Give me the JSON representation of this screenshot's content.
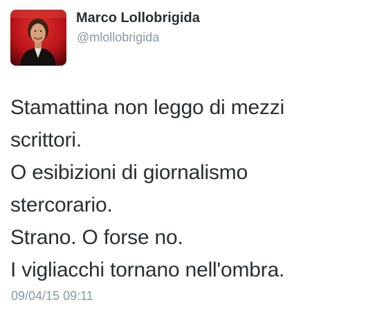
{
  "tweet": {
    "author": {
      "name": "Marco Lollobrigida",
      "handle": "@mlollobrigida",
      "avatar": "profile-photo"
    },
    "text_lines": [
      "Stamattina non leggo di mezzi",
      "scrittori.",
      "O esibizioni di giornalismo",
      "stercorario.",
      "Strano. O forse no.",
      "I vigliacchi tornano nell'ombra."
    ],
    "timestamp": "09/04/15 09:11"
  },
  "colors": {
    "name": "#292f33",
    "secondary": "#8899a6",
    "avatar_background": "#c4141a"
  }
}
